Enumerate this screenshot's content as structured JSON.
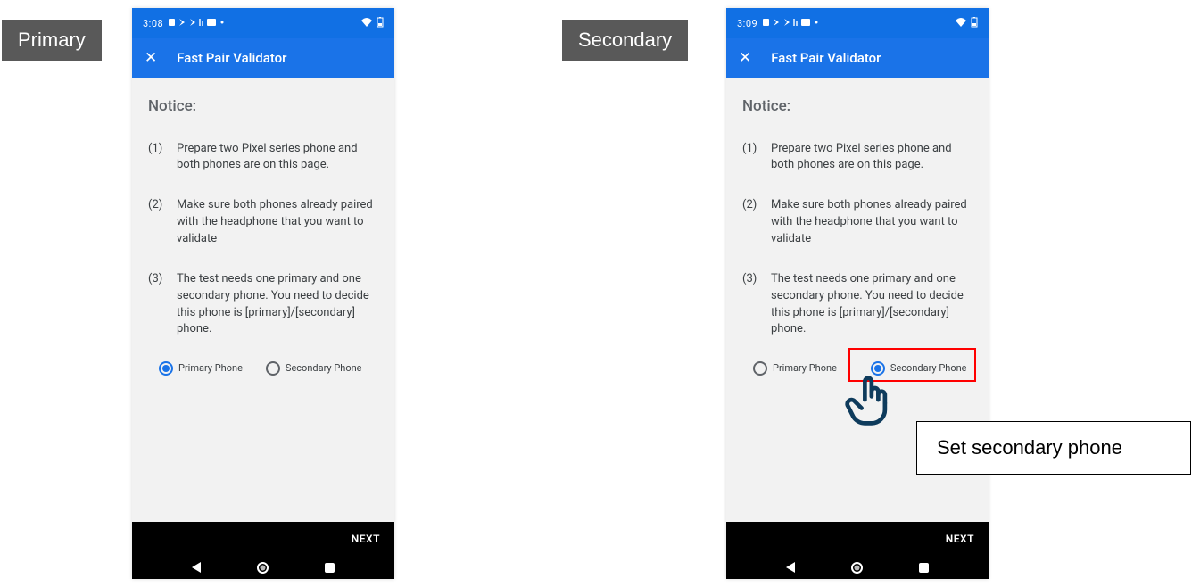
{
  "tags": {
    "left": "Primary",
    "right": "Secondary"
  },
  "statusbar": {
    "time_left": "3:08",
    "time_right": "3:09",
    "icons_text": "⌂ ⋈ ▾ ▣ •"
  },
  "appbar": {
    "title": "Fast Pair Validator"
  },
  "notice": {
    "title": "Notice:",
    "steps": [
      {
        "num": "(1)",
        "text": "Prepare two Pixel series phone and both phones are on this page."
      },
      {
        "num": "(2)",
        "text": "Make sure both phones already paired with the headphone that you want to validate"
      },
      {
        "num": "(3)",
        "text": "The test needs one primary and one secondary phone. You need to decide this phone is [primary]/[secondary] phone."
      }
    ]
  },
  "radios": {
    "primary": "Primary Phone",
    "secondary": "Secondary Phone"
  },
  "footer": {
    "next": "NEXT"
  },
  "callout": "Set secondary phone"
}
